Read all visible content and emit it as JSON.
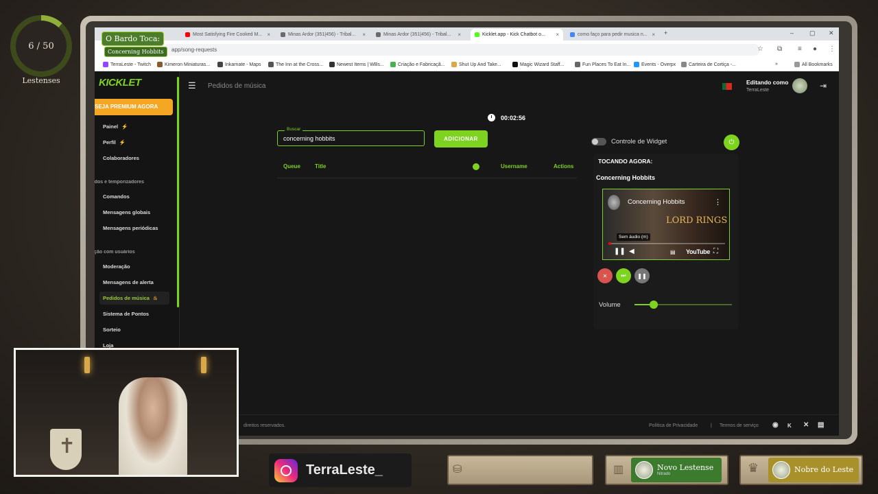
{
  "overlay": {
    "progress_text": "6 / 50",
    "progress_fraction": 0.12,
    "group_label": "Lestenses",
    "bardo_title": "O Bardo Toca:",
    "bardo_song": "Concerning Hobbits",
    "instagram_handle": "TerraLeste_",
    "badge_novo": "Novo Lestense",
    "badge_novo_sub": "Nitrado",
    "badge_nobre": "Nobre do Leste"
  },
  "browser": {
    "tabs": [
      {
        "label": "Most Satisfying Fire Cooked M...",
        "color": "#ff0000"
      },
      {
        "label": "Minas Ardor (351|456) - Tribal...",
        "color": "#6b6b6b"
      },
      {
        "label": "Minas Ardor (351|456) - Tribal...",
        "color": "#6b6b6b"
      },
      {
        "label": "Kicklet.app - Kick Chatbot o...",
        "color": "#53fc18"
      },
      {
        "label": "como faço para pedir musica n...",
        "color": "#4285f4"
      }
    ],
    "url": "app/song-requests",
    "bookmarks": [
      {
        "label": "TerraLeste - Twitch",
        "color": "#9146ff"
      },
      {
        "label": "Kimeron Miniaturas...",
        "color": "#8b5a2b"
      },
      {
        "label": "Inkarnate - Maps",
        "color": "#444"
      },
      {
        "label": "The Inn at the Cross...",
        "color": "#555"
      },
      {
        "label": "Newest Items | WBs...",
        "color": "#333"
      },
      {
        "label": "Criação e Fabricaçã...",
        "color": "#4caf50"
      },
      {
        "label": "Shut Up And Take...",
        "color": "#d9a84a"
      },
      {
        "label": "Magic Wizard Staff...",
        "color": "#111"
      },
      {
        "label": "Fun Places To Eat In...",
        "color": "#666"
      },
      {
        "label": "Events - Overpx",
        "color": "#2196f3"
      },
      {
        "label": "Carteira de Cortiça -...",
        "color": "#888"
      }
    ],
    "all_bookmarks": "All Bookmarks"
  },
  "app": {
    "logo": "KICKLET",
    "premium": "SEJA PREMIUM AGORA",
    "nav": {
      "painel": "Painel",
      "perfil": "Perfil",
      "colaboradores": "Colaboradores",
      "section_commands": "Comandos e temporizadores",
      "comandos": "Comandos",
      "globais": "Mensagens globais",
      "periodicas": "Mensagens periódicas",
      "section_users": "Interação com usuários",
      "moderacao": "Moderação",
      "alerta": "Mensagens de alerta",
      "pedidos": "Pedidos de música",
      "pontos": "Sistema de Pontos",
      "sorteio": "Sorteio",
      "loja": "Loja"
    },
    "page_title": "Pedidos de música",
    "editing_label": "Editando como",
    "editing_user": "TerraLeste",
    "timer": "00:02:56",
    "search": {
      "label": "Buscar",
      "value": "concerning hobbits"
    },
    "add_button": "ADICIONAR",
    "table_headers": {
      "queue": "Queue",
      "title": "Title",
      "username": "Username",
      "actions": "Actions"
    },
    "widget_control": "Controle de Widget",
    "now_playing_label": "TOCANDO AGORA:",
    "now_playing_song": "Concerning Hobbits",
    "video": {
      "title": "Concerning Hobbits",
      "tooltip": "Sem áudio (m)",
      "brand": "YouTube",
      "poster_text": "LORD RINGS"
    },
    "volume_label": "Volume",
    "volume_level": 0.2,
    "footer_rights": "direitos reservados.",
    "footer_privacy": "Política de Privacidade",
    "footer_sep": "|",
    "footer_terms": "Termos de serviço"
  }
}
